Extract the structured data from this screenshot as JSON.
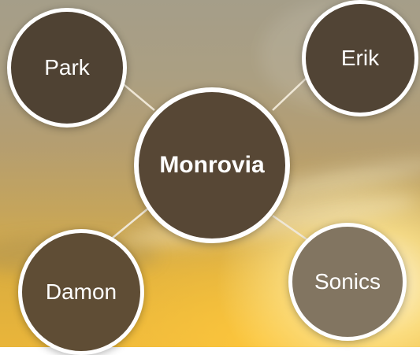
{
  "nodes": {
    "center": "Monrovia",
    "top_left": "Park",
    "top_right": "Erik",
    "bottom_left": "Damon",
    "bottom_right": "Sonics"
  },
  "colors": {
    "node_fill": "#574735",
    "node_border": "#ffffff",
    "link_stroke": "#efe7d6",
    "label_text": "#ffffff"
  }
}
